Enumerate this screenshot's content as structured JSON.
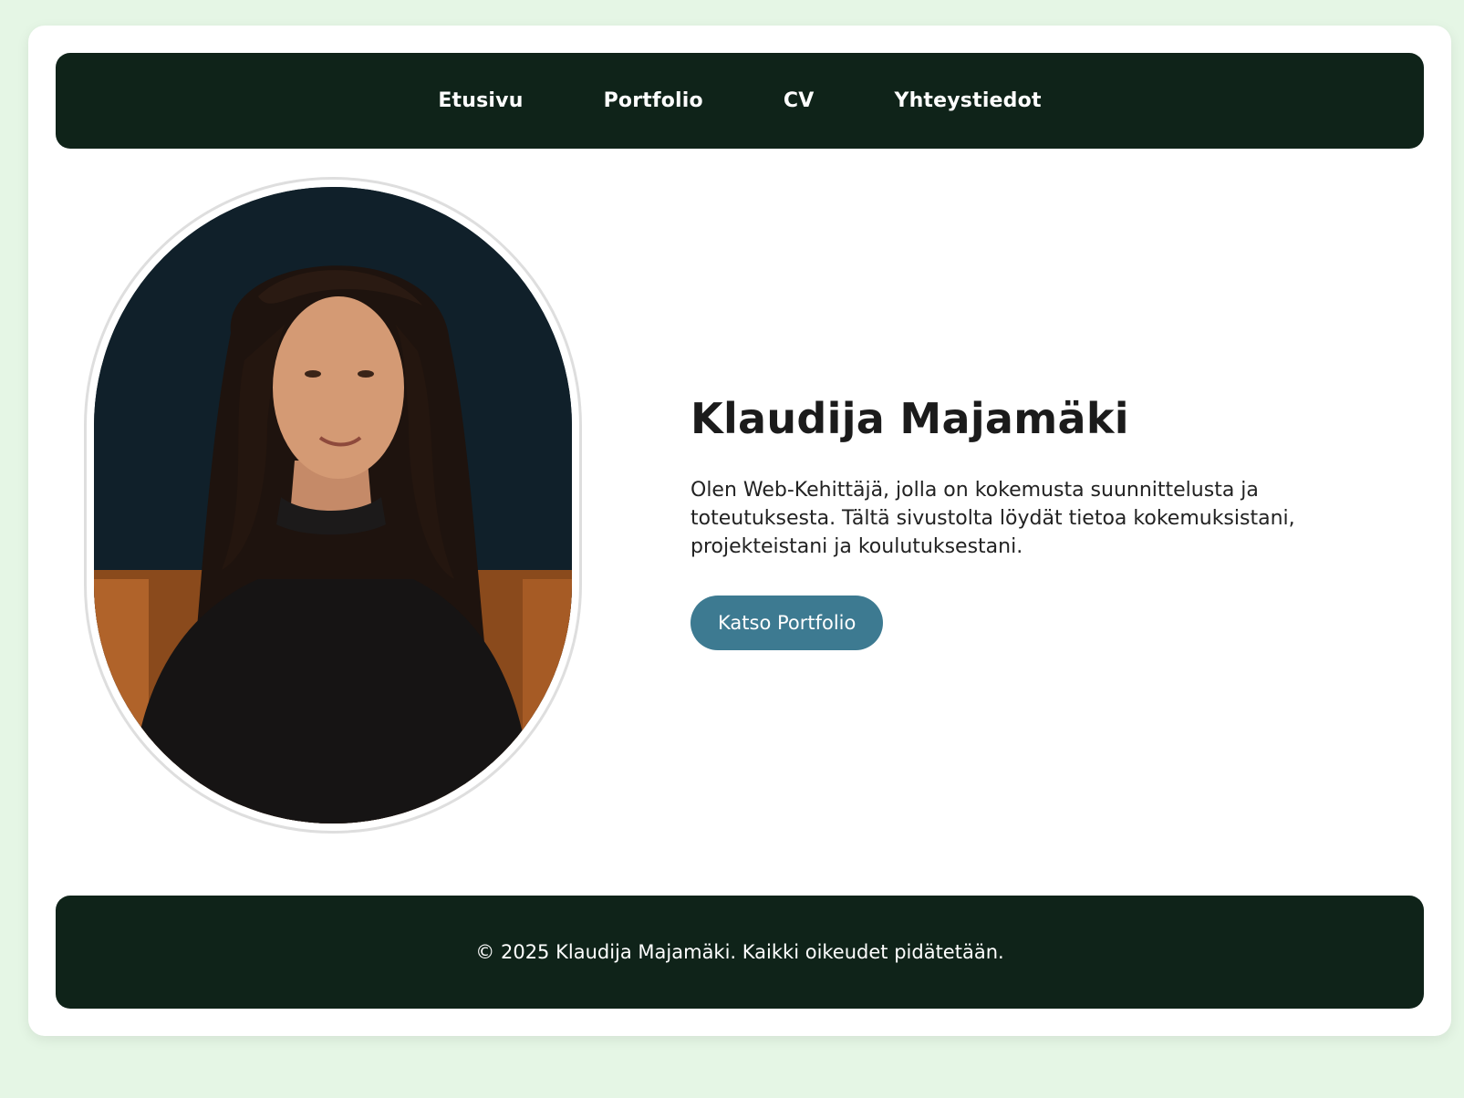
{
  "nav": {
    "items": [
      {
        "label": "Etusivu"
      },
      {
        "label": "Portfolio"
      },
      {
        "label": "CV"
      },
      {
        "label": "Yhteystiedot"
      }
    ]
  },
  "hero": {
    "name": "Klaudija Majamäki",
    "description": "Olen Web-Kehittäjä, jolla on kokemusta suunnittelusta ja toteutuksesta. Tältä sivustolta löydät tietoa kokemuksistani, projekteistani ja koulutuksestani.",
    "cta_label": "Katso Portfolio"
  },
  "footer": {
    "text": "© 2025 Klaudija Majamäki. Kaikki oikeudet pidätetään."
  },
  "colors": {
    "page_background": "#e5f6e5",
    "nav_background": "#0f2319",
    "button": "#3d7a91"
  }
}
